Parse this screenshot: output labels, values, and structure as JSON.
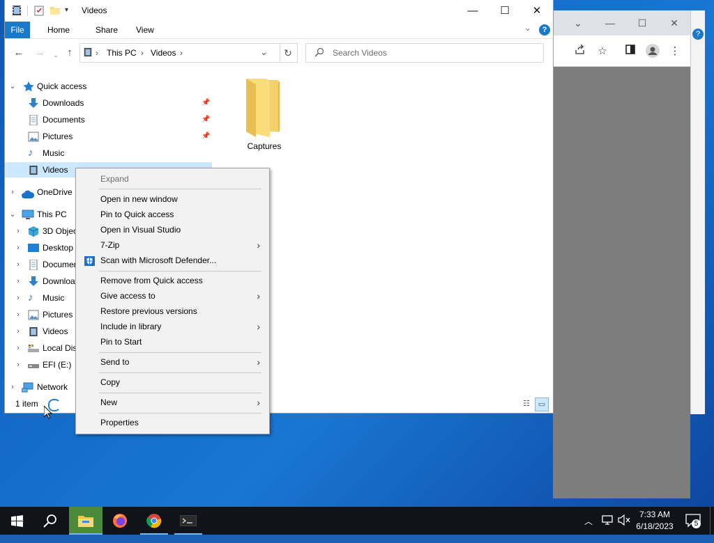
{
  "chrome_window": {
    "controls": [
      "⌄",
      "—",
      "☐",
      "✕"
    ],
    "toolbar_icons": [
      "share-icon",
      "star-icon",
      "sidepanel-icon",
      "profile-icon",
      "more-icon"
    ]
  },
  "explorer": {
    "title": "Videos",
    "ribbon_tabs": [
      "File",
      "Home",
      "Share",
      "View"
    ],
    "address": {
      "crumbs": [
        "This PC",
        "Videos"
      ]
    },
    "search": {
      "placeholder": "Search Videos",
      "value": ""
    },
    "nav": {
      "quick_access": "Quick access",
      "quick_items": [
        "Downloads",
        "Documents",
        "Pictures",
        "Music",
        "Videos"
      ],
      "onedrive": "OneDrive",
      "this_pc": "This PC",
      "pc_items": [
        "3D Objects",
        "Desktop",
        "Documents",
        "Downloads",
        "Music",
        "Pictures",
        "Videos",
        "Local Disk (C:)",
        "EFI (E:)"
      ],
      "network": "Network"
    },
    "content": {
      "items": [
        {
          "name": "Captures",
          "type": "folder"
        }
      ]
    },
    "status": "1 item"
  },
  "context_menu": {
    "items": [
      {
        "label": "Expand",
        "disabled": true
      },
      {
        "label": "Open in new window"
      },
      {
        "label": "Pin to Quick access"
      },
      {
        "label": "Open in Visual Studio"
      },
      {
        "label": "7-Zip",
        "submenu": true
      },
      {
        "label": "Scan with Microsoft Defender..."
      },
      {
        "label": "Remove from Quick access"
      },
      {
        "label": "Give access to",
        "submenu": true
      },
      {
        "label": "Restore previous versions"
      },
      {
        "label": "Include in library",
        "submenu": true
      },
      {
        "label": "Pin to Start"
      },
      {
        "label": "Send to",
        "submenu": true
      },
      {
        "label": "Copy"
      },
      {
        "label": "New",
        "submenu": true
      },
      {
        "label": "Properties"
      }
    ]
  },
  "taskbar": {
    "apps": [
      "start",
      "search",
      "file-explorer",
      "firefox",
      "chrome",
      "terminal"
    ],
    "tray": {
      "time": "7:33 AM",
      "date": "6/18/2023",
      "notifications": "5"
    }
  }
}
